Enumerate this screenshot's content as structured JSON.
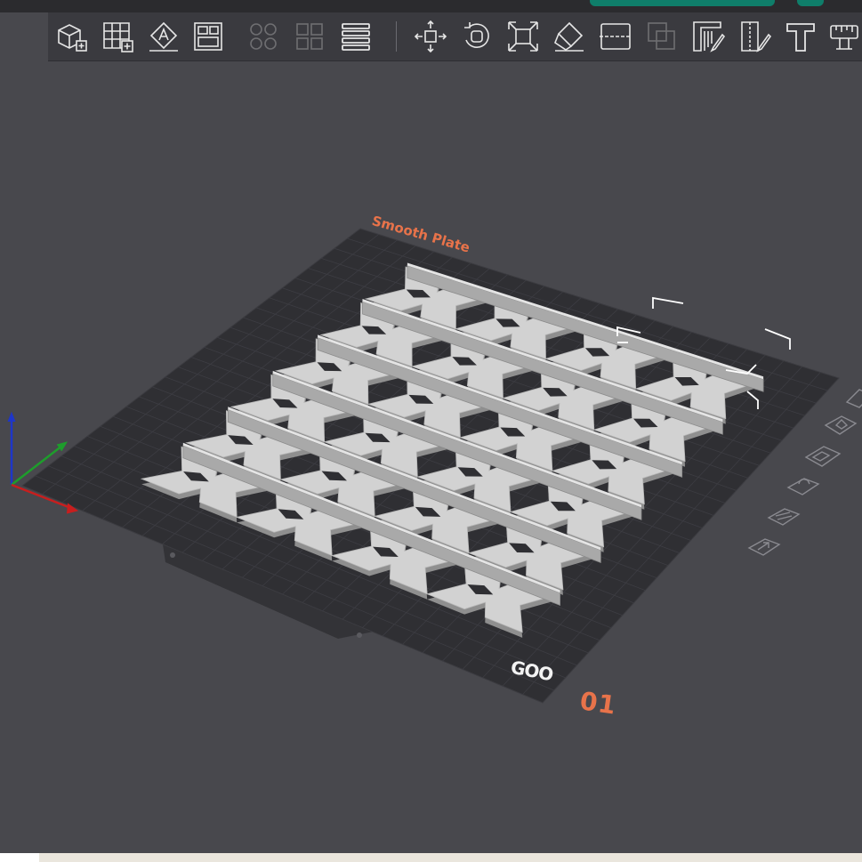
{
  "app": {
    "top_tabs": [
      "",
      ""
    ]
  },
  "toolbar": {
    "tools": [
      {
        "name": "add-object-icon",
        "enabled": true
      },
      {
        "name": "add-plate-icon",
        "enabled": true
      },
      {
        "name": "auto-orient-icon",
        "enabled": true
      },
      {
        "name": "arrange-icon",
        "enabled": true
      },
      {
        "name": "split-objects-icon",
        "enabled": false
      },
      {
        "name": "split-parts-icon",
        "enabled": false
      },
      {
        "name": "layers-icon",
        "enabled": true
      },
      {
        "name": "move-icon",
        "enabled": true
      },
      {
        "name": "rotate-icon",
        "enabled": true
      },
      {
        "name": "scale-icon",
        "enabled": true
      },
      {
        "name": "lay-on-face-icon",
        "enabled": true
      },
      {
        "name": "cut-icon",
        "enabled": true
      },
      {
        "name": "boolean-icon",
        "enabled": false
      },
      {
        "name": "support-paint-icon",
        "enabled": true
      },
      {
        "name": "seam-paint-icon",
        "enabled": true
      },
      {
        "name": "text-icon",
        "enabled": true
      },
      {
        "name": "measure-icon",
        "enabled": true
      }
    ]
  },
  "plate": {
    "name": "Smooth Plate",
    "number": "01",
    "brand": "GOO"
  },
  "plate_tools": [
    {
      "name": "delete-plate-icon"
    },
    {
      "name": "orient-plate-icon"
    },
    {
      "name": "arrange-plate-icon"
    },
    {
      "name": "lock-plate-icon"
    },
    {
      "name": "plate-settings-icon"
    },
    {
      "name": "move-plate-icon"
    }
  ],
  "colors": {
    "background": "#48484d",
    "bed": "#2f2f33",
    "model": "#cfcfcf",
    "accent": "#e8734a",
    "brand_green": "#0f7e6a"
  }
}
